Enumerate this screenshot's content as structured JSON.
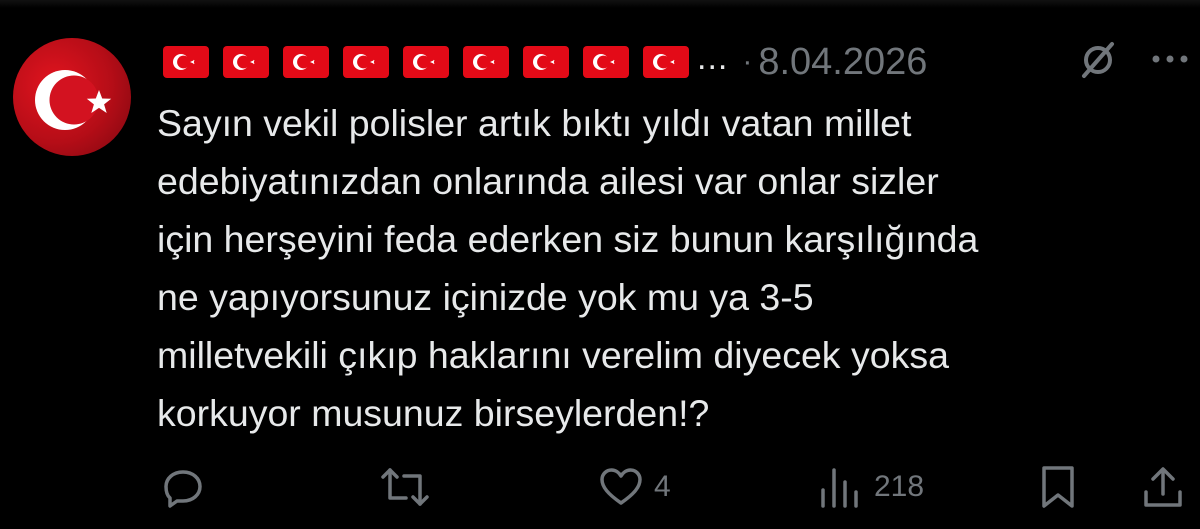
{
  "post": {
    "avatar_icon": "turkish-flag-avatar",
    "author_display_flags_count": 9,
    "author_truncation": "...",
    "separator": "·",
    "date": "8.04.2026",
    "text": "Sayın vekil polisler artık bıktı yıldı vatan millet\nedebiyatınızdan onlarında ailesi var onlar sizler\niçin herşeyini feda ederken siz bunun karşılığında\nne yapıyorsunuz içinizde yok mu ya 3-5\nmilletvekili çıkıp haklarını verelim diyecek yoksa\nkorkuyor musunuz birseylerden!?"
  },
  "actions": {
    "reply": {
      "icon": "reply-icon",
      "count": ""
    },
    "repost": {
      "icon": "repost-icon",
      "count": ""
    },
    "like": {
      "icon": "heart-icon",
      "count": "4"
    },
    "views": {
      "icon": "views-icon",
      "count": "218"
    },
    "bookmark": {
      "icon": "bookmark-icon"
    },
    "share": {
      "icon": "share-icon"
    }
  },
  "colors": {
    "background": "#000000",
    "text": "#e7e9ea",
    "muted": "#71767b",
    "flag_red": "#e30a17",
    "flag_white": "#ffffff"
  }
}
